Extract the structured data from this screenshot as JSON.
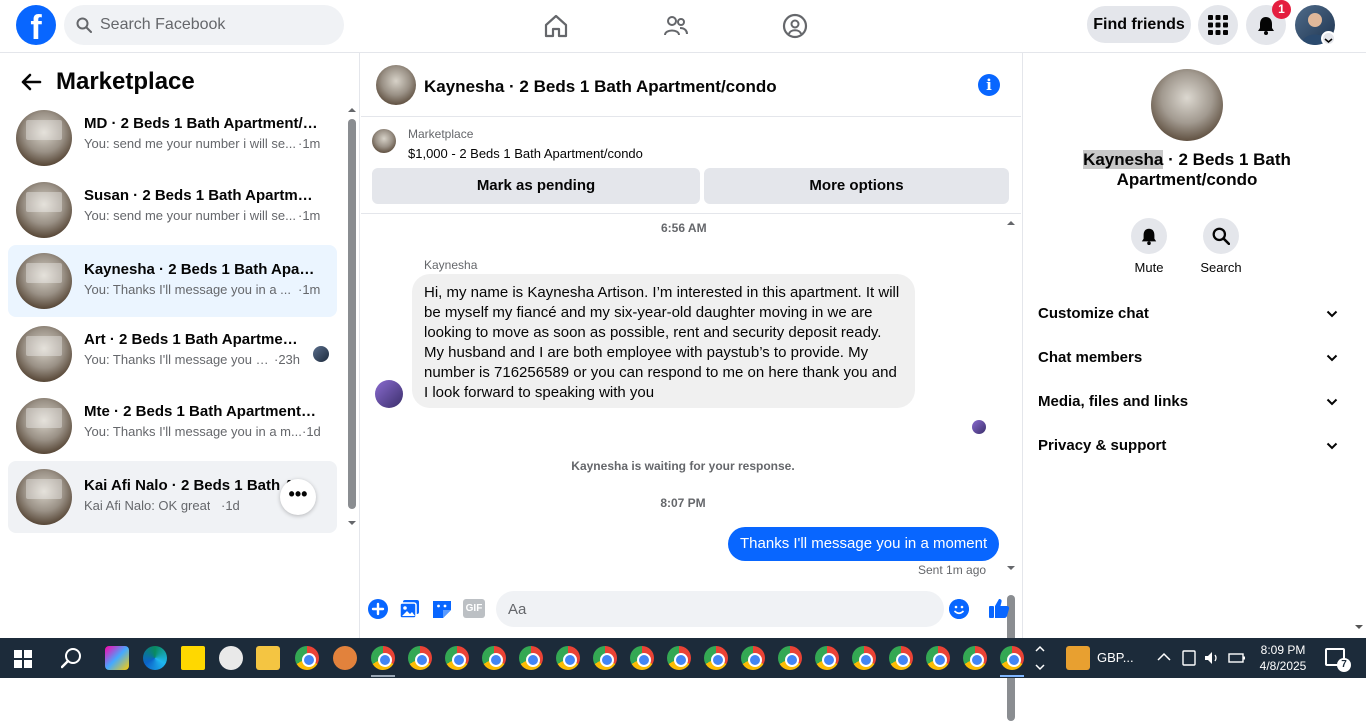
{
  "header": {
    "logo_letter": "f",
    "search_placeholder": "Search Facebook",
    "find_friends_label": "Find friends",
    "notification_count": "1",
    "icons": [
      "home-icon",
      "friends-icon",
      "groups-icon",
      "apps-grid-icon",
      "bell-icon"
    ]
  },
  "sidebar": {
    "title": "Marketplace",
    "conversations": [
      {
        "title": "MD · 2 Beds 1 Bath Apartment/c...",
        "subtitle": "You: send me your number i will se...",
        "time": "·1m"
      },
      {
        "title": "Susan · 2 Beds 1 Bath Apartment...",
        "subtitle": "You: send me your number i will se...",
        "time": "·1m"
      },
      {
        "title": "Kaynesha · 2 Beds 1 Bath Apart...",
        "subtitle": "You: Thanks I'll message you in a ...",
        "time": "·1m"
      },
      {
        "title": "Art · 2 Beds 1 Bath Apartment...",
        "subtitle": "You: Thanks I'll message you in...",
        "time": "·23h"
      },
      {
        "title": "Mte · 2 Beds 1 Bath Apartment/c...",
        "subtitle": "You: Thanks I'll message you in a m...",
        "time": "·1d"
      },
      {
        "title": "Kai Afi Nalo · 2 Beds 1 Bath A...",
        "subtitle": "Kai Afi Nalo: OK great",
        "time": "·1d"
      }
    ],
    "more_label": "•••"
  },
  "chat": {
    "title": "Kaynesha · 2 Beds 1 Bath Apartment/condo",
    "info_label": "i",
    "listing": {
      "label": "Marketplace",
      "price_title": "$1,000 - 2 Beds 1 Bath Apartment/condo",
      "mark_pending_label": "Mark as pending",
      "more_options_label": "More options"
    },
    "time_first": "6:56 AM",
    "sender_name": "Kaynesha",
    "incoming_message": "Hi, my name is Kaynesha Artison. I’m interested in this apartment. It will be myself my fiancé and my six-year-old daughter moving in we are looking to move as soon as possible, rent and security deposit ready. My husband and I are both employee with paystub’s to provide. My number is 716256589 or you can respond to me on here thank you and I look forward to speaking with you",
    "waiting_text": "Kaynesha is waiting for your response.",
    "time_second": "8:07 PM",
    "outgoing_message": "Thanks I'll message you in a moment",
    "sent_status": "Sent 1m ago",
    "composer_placeholder": "Aa",
    "gif_label": "GIF"
  },
  "details": {
    "name_highlight": "Kaynesha",
    "name_rest": " · 2 Beds 1 Bath Apartment/condo",
    "actions": [
      {
        "label": "Mute",
        "icon": "bell-icon"
      },
      {
        "label": "Search",
        "icon": "search-icon"
      }
    ],
    "sections": [
      {
        "label": "Customize chat"
      },
      {
        "label": "Chat members"
      },
      {
        "label": "Media, files and links"
      },
      {
        "label": "Privacy & support"
      }
    ]
  },
  "taskbar": {
    "currency": "GBP...",
    "time": "8:09 PM",
    "date": "4/8/2025",
    "notification_count": "7"
  },
  "colors": {
    "brand": "#0866ff",
    "active_row": "#ebf5ff",
    "badge": "#e41e3f"
  }
}
